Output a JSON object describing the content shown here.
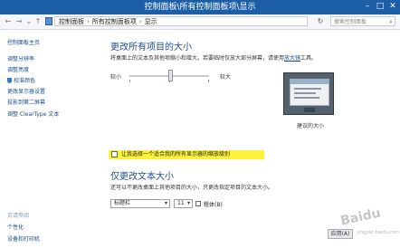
{
  "window": {
    "title": "控制面板\\所有控制面板项\\显示"
  },
  "address": {
    "crumbs": [
      "控制面板",
      "所有控制面板项",
      "显示"
    ],
    "search_placeholder": "搜索控制面板"
  },
  "sidebar": {
    "home": "控制面板主页",
    "items": [
      "调整分辨率",
      "调整亮度",
      "校准颜色",
      "更改显示器设置",
      "投影到第二屏幕",
      "调整 ClearType 文本"
    ],
    "see_also_heading": "另请参阅",
    "see_also": [
      "个性化",
      "设备和打印机"
    ]
  },
  "main": {
    "heading1": "更改所有项目的大小",
    "desc1_text": "将桌面上的文本及其他项缩小和增大。若要临时仅放大部分屏幕，请使用",
    "desc1_link": "放大镜",
    "desc1_suffix": "工具。",
    "slider_small": "较小",
    "slider_large": "较大",
    "preview_label": "建议的大小",
    "checkbox_label": "让我选择一个适合我的所有显示器的缩放级别",
    "heading2": "仅更改文本大小",
    "desc2": "还可以不更改桌面上其他项目的大小，只更改指定项目的文本大小。",
    "element_select": "标题栏",
    "size_select": "11",
    "bold_label": "粗体(B)",
    "apply_button": "应用(A)"
  },
  "watermark": {
    "text": "Baidu",
    "sub": "jingyan.baidu.com"
  },
  "colors": {
    "titlebar": "#1d5fa6",
    "heading": "#1e4d96",
    "link": "#1a4c8c",
    "highlight": "#fff23a"
  }
}
